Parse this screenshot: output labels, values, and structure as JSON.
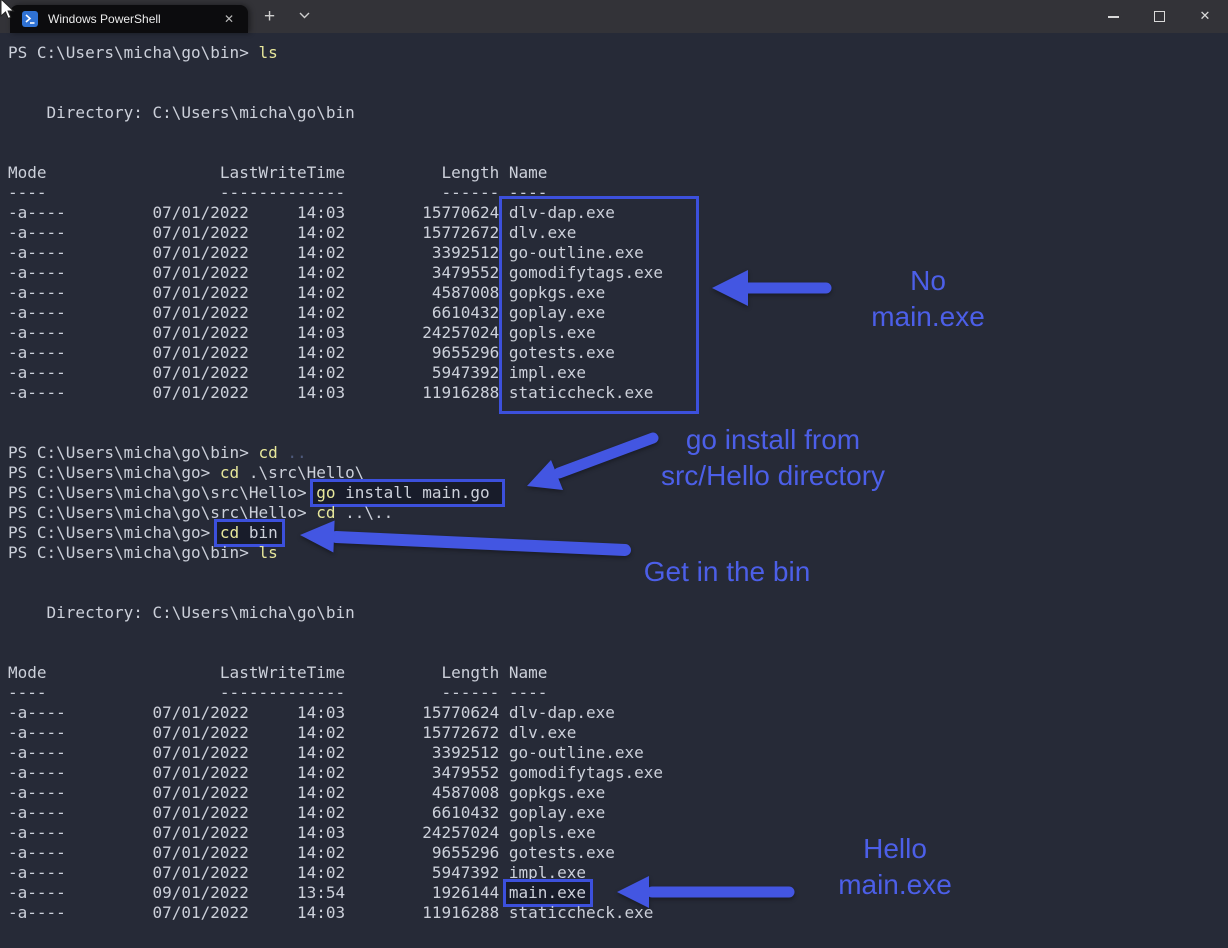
{
  "window": {
    "tab_title": "Windows PowerShell",
    "tab_close_glyph": "✕",
    "new_tab_glyph": "+",
    "close_glyph": "✕"
  },
  "icons": {
    "tab_icon": "powershell-icon",
    "new_tab": "plus",
    "tab_dropdown": "chevron-down",
    "minimize": "minus-line",
    "maximize": "square-outline",
    "close": "close-x"
  },
  "colors": {
    "terminal_bg": "#262a37",
    "titlebar_bg": "#333338",
    "tab_bg": "#0c0c0e",
    "text_plain": "#ccd0da",
    "text_command": "#e7e79b",
    "text_dim": "#4e5a7c",
    "annotation_blue": "#4356e2",
    "annotation_text_blue": "#4c5fe8",
    "box_blue": "#3c50dc",
    "tab_text": "#ececec",
    "control_icon": "#d9d9d9",
    "ps_icon_blue": "#2f72d4"
  },
  "terminal": {
    "listings": [
      {
        "directory": "C:\\Users\\micha\\go\\bin",
        "columns": [
          "Mode",
          "LastWriteTime",
          "Length",
          "Name"
        ],
        "boxed_name": null,
        "rows": [
          [
            "-a----",
            "07/01/2022",
            "14:03",
            "15770624",
            "dlv-dap.exe"
          ],
          [
            "-a----",
            "07/01/2022",
            "14:02",
            "15772672",
            "dlv.exe"
          ],
          [
            "-a----",
            "07/01/2022",
            "14:02",
            "3392512",
            "go-outline.exe"
          ],
          [
            "-a----",
            "07/01/2022",
            "14:02",
            "3479552",
            "gomodifytags.exe"
          ],
          [
            "-a----",
            "07/01/2022",
            "14:02",
            "4587008",
            "gopkgs.exe"
          ],
          [
            "-a----",
            "07/01/2022",
            "14:02",
            "6610432",
            "goplay.exe"
          ],
          [
            "-a----",
            "07/01/2022",
            "14:03",
            "24257024",
            "gopls.exe"
          ],
          [
            "-a----",
            "07/01/2022",
            "14:02",
            "9655296",
            "gotests.exe"
          ],
          [
            "-a----",
            "07/01/2022",
            "14:02",
            "5947392",
            "impl.exe"
          ],
          [
            "-a----",
            "07/01/2022",
            "14:03",
            "11916288",
            "staticcheck.exe"
          ]
        ]
      },
      {
        "directory": "C:\\Users\\micha\\go\\bin",
        "columns": [
          "Mode",
          "LastWriteTime",
          "Length",
          "Name"
        ],
        "boxed_name": "main.exe",
        "rows": [
          [
            "-a----",
            "07/01/2022",
            "14:03",
            "15770624",
            "dlv-dap.exe"
          ],
          [
            "-a----",
            "07/01/2022",
            "14:02",
            "15772672",
            "dlv.exe"
          ],
          [
            "-a----",
            "07/01/2022",
            "14:02",
            "3392512",
            "go-outline.exe"
          ],
          [
            "-a----",
            "07/01/2022",
            "14:02",
            "3479552",
            "gomodifytags.exe"
          ],
          [
            "-a----",
            "07/01/2022",
            "14:02",
            "4587008",
            "gopkgs.exe"
          ],
          [
            "-a----",
            "07/01/2022",
            "14:02",
            "6610432",
            "goplay.exe"
          ],
          [
            "-a----",
            "07/01/2022",
            "14:03",
            "24257024",
            "gopls.exe"
          ],
          [
            "-a----",
            "07/01/2022",
            "14:02",
            "9655296",
            "gotests.exe"
          ],
          [
            "-a----",
            "07/01/2022",
            "14:02",
            "5947392",
            "impl.exe"
          ],
          [
            "-a----",
            "09/01/2022",
            "13:54",
            "1926144",
            "main.exe"
          ],
          [
            "-a----",
            "07/01/2022",
            "14:03",
            "11916288",
            "staticcheck.exe"
          ]
        ]
      }
    ],
    "screen": [
      {
        "segs": [
          {
            "t": "PS C:\\Users\\micha\\go\\bin> "
          },
          {
            "t": "ls",
            "c": "cmd"
          }
        ]
      },
      {
        "blank": true
      },
      {
        "blank": true
      },
      {
        "segs": [
          {
            "t": "    Directory: C:\\Users\\micha\\go\\bin"
          }
        ]
      },
      {
        "blank": true
      },
      {
        "blank": true
      },
      {
        "table": 0
      },
      {
        "blank": true
      },
      {
        "blank": true
      },
      {
        "segs": [
          {
            "t": "PS C:\\Users\\micha\\go\\bin> "
          },
          {
            "t": "cd",
            "c": "cmd"
          },
          {
            "t": " "
          },
          {
            "t": "..",
            "c": "dim"
          }
        ]
      },
      {
        "segs": [
          {
            "t": "PS C:\\Users\\micha\\go> "
          },
          {
            "t": "cd",
            "c": "cmd"
          },
          {
            "t": " .\\src\\Hello\\"
          }
        ]
      },
      {
        "segs": [
          {
            "t": "PS C:\\Users\\micha\\go\\src\\Hello> "
          },
          {
            "box": [
              {
                "t": "go",
                "c": "cmd"
              },
              {
                "t": " install main.go"
              }
            ]
          }
        ]
      },
      {
        "segs": [
          {
            "t": "PS C:\\Users\\micha\\go\\src\\Hello> "
          },
          {
            "t": "cd",
            "c": "cmd"
          },
          {
            "t": " ..\\.."
          }
        ]
      },
      {
        "segs": [
          {
            "t": "PS C:\\Users\\micha\\go> "
          },
          {
            "box": [
              {
                "t": "cd",
                "c": "cmd"
              },
              {
                "t": " bin"
              }
            ],
            "tight": true
          }
        ]
      },
      {
        "segs": [
          {
            "t": "PS C:\\Users\\micha\\go\\bin> "
          },
          {
            "t": "ls",
            "c": "cmd"
          }
        ]
      },
      {
        "blank": true
      },
      {
        "blank": true
      },
      {
        "segs": [
          {
            "t": "    Directory: C:\\Users\\micha\\go\\bin"
          }
        ]
      },
      {
        "blank": true
      },
      {
        "blank": true
      },
      {
        "table": 1
      }
    ]
  },
  "annotations": {
    "no_main": {
      "text": [
        "No",
        "main.exe"
      ]
    },
    "go_install": {
      "text": [
        "go install from",
        "src/Hello directory"
      ]
    },
    "get_in_bin": {
      "text": [
        "Get in the bin"
      ]
    },
    "hello_main": {
      "text": [
        "Hello",
        "main.exe"
      ]
    }
  }
}
